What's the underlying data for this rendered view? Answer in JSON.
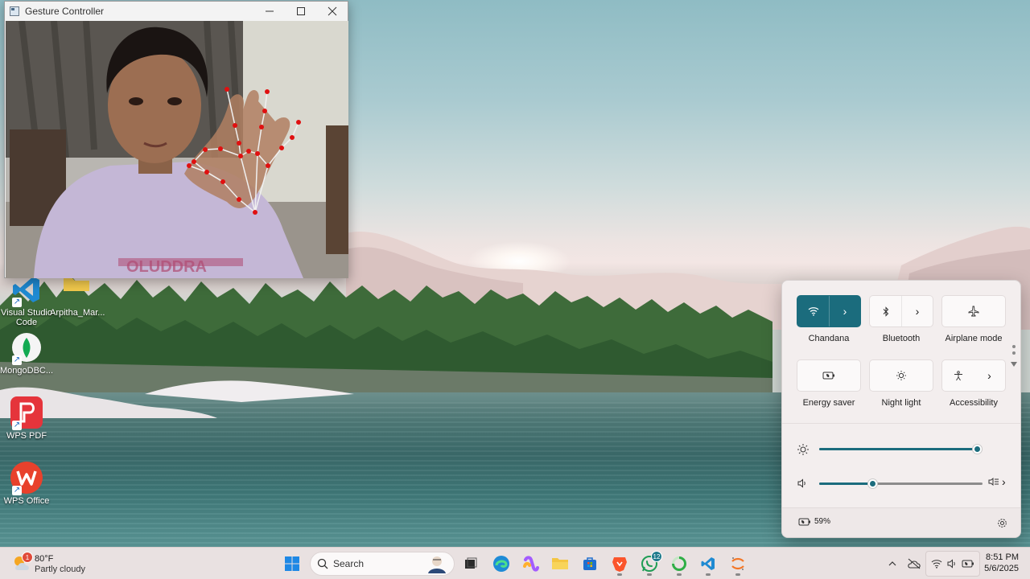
{
  "window": {
    "title": "Gesture Controller",
    "minimize_icon": "minimize-icon",
    "maximize_icon": "maximize-icon",
    "close_icon": "close-icon",
    "camera_shirt_text": "OLUDDRA"
  },
  "desktop": {
    "icons": [
      {
        "label": "Visual Studio Code",
        "icon": "vscode-icon"
      },
      {
        "label": "Arpitha_Mar...",
        "icon": "folder-icon"
      },
      {
        "label": "MongoDBC...",
        "icon": "mongodb-compass-icon"
      },
      {
        "label": "WPS PDF",
        "icon": "wps-pdf-icon"
      },
      {
        "label": "WPS Office",
        "icon": "wps-office-icon"
      }
    ]
  },
  "quick_settings": {
    "tiles": [
      {
        "label": "Chandana",
        "icon": "wifi-icon",
        "active": true,
        "has_chevron": true
      },
      {
        "label": "Bluetooth",
        "icon": "bluetooth-icon",
        "active": false,
        "has_chevron": true
      },
      {
        "label": "Airplane mode",
        "icon": "airplane-icon",
        "active": false,
        "has_chevron": false
      },
      {
        "label": "Energy saver",
        "icon": "energy-saver-icon",
        "active": false,
        "has_chevron": false
      },
      {
        "label": "Night light",
        "icon": "night-light-icon",
        "active": false,
        "has_chevron": false
      },
      {
        "label": "Accessibility",
        "icon": "accessibility-icon",
        "active": false,
        "has_chevron": true
      }
    ],
    "brightness": {
      "icon": "brightness-icon",
      "value": 0.98
    },
    "volume": {
      "icon": "speaker-icon",
      "value": 0.33,
      "output_icon": "audio-output-icon"
    },
    "battery": {
      "icon": "battery-saver-icon",
      "percent": "59%"
    },
    "settings_icon": "settings-gear-icon",
    "accent": "#1b6c7d"
  },
  "taskbar": {
    "weather": {
      "temp": "80°F",
      "condition": "Partly cloudy",
      "badge": "1"
    },
    "search": {
      "label": "Search"
    },
    "apps": [
      {
        "name": "start-button",
        "icon": "windows-icon"
      },
      {
        "name": "task-view",
        "icon": "task-view-icon"
      },
      {
        "name": "edge",
        "icon": "edge-icon"
      },
      {
        "name": "copilot",
        "icon": "copilot-icon"
      },
      {
        "name": "file-explorer",
        "icon": "folder-icon"
      },
      {
        "name": "store",
        "icon": "store-icon"
      },
      {
        "name": "brave",
        "icon": "brave-icon"
      },
      {
        "name": "whatsapp",
        "icon": "whatsapp-icon",
        "badge": "12"
      },
      {
        "name": "loading-app",
        "icon": "spinner-icon"
      },
      {
        "name": "vscode",
        "icon": "vscode-icon"
      },
      {
        "name": "jupyter",
        "icon": "jupyter-icon"
      }
    ],
    "clock": {
      "time": "8:51 PM",
      "date": "5/6/2025"
    }
  }
}
